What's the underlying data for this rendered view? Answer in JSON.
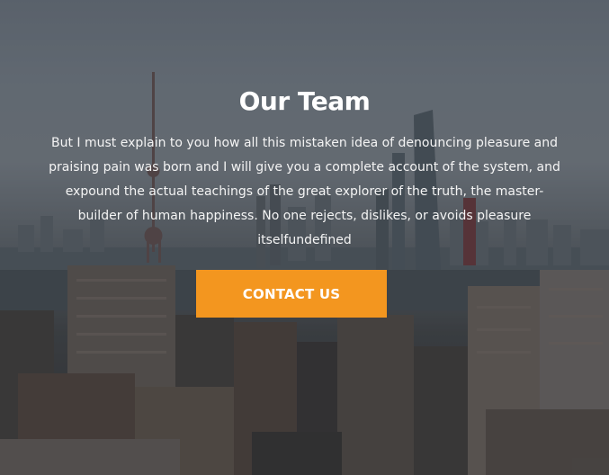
{
  "hero": {
    "title": "Our Team",
    "description": "But I must explain to you how all this mistaken idea of denouncing pleasure and praising pain was born and I will give you a complete account of the system, and expound the actual teachings of the great explorer of the truth, the master-builder of human happiness. No one rejects, dislikes, or avoids pleasure itselfundefined",
    "cta_label": "CONTACT US",
    "accent_color": "#f3961f"
  }
}
